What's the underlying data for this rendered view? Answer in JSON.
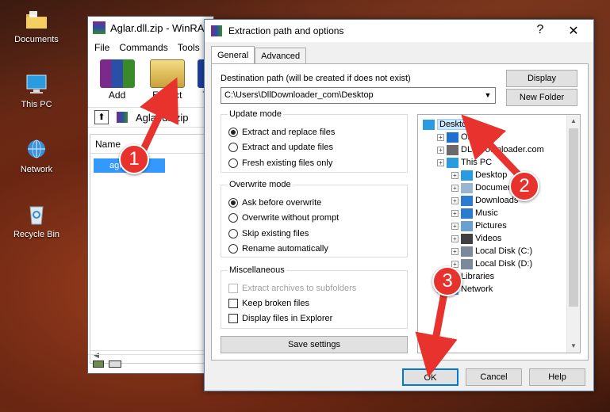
{
  "desktop": {
    "icons": [
      {
        "label": "Documents",
        "icon": "folder-icon"
      },
      {
        "label": "This PC",
        "icon": "computer-icon"
      },
      {
        "label": "Network",
        "icon": "network-icon"
      },
      {
        "label": "Recycle Bin",
        "icon": "recycle-bin-icon"
      }
    ]
  },
  "winrar": {
    "title": "Aglar.dll.zip - WinRAR",
    "menu": [
      "File",
      "Commands",
      "Tools"
    ],
    "toolbar": {
      "add": "Add",
      "extract_to": "Extract To",
      "third": "T"
    },
    "address": "Aglar.dll.zip",
    "list_header": "Name",
    "selected_file": "aglar.dll"
  },
  "dialog": {
    "title": "Extraction path and options",
    "help": "?",
    "close": "✕",
    "tabs": [
      "General",
      "Advanced"
    ],
    "dest_label": "Destination path (will be created if does not exist)",
    "dest_value": "C:\\Users\\DllDownloader_com\\Desktop",
    "display_btn": "Display",
    "new_folder_btn": "New Folder",
    "update_mode": {
      "title": "Update mode",
      "options": [
        "Extract and replace files",
        "Extract and update files",
        "Fresh existing files only"
      ],
      "selected": 0
    },
    "overwrite_mode": {
      "title": "Overwrite mode",
      "options": [
        "Ask before overwrite",
        "Overwrite without prompt",
        "Skip existing files",
        "Rename automatically"
      ],
      "selected": 0
    },
    "misc": {
      "title": "Miscellaneous",
      "options": [
        "Extract archives to subfolders",
        "Keep broken files",
        "Display files in Explorer"
      ]
    },
    "save_settings": "Save settings",
    "tree": [
      {
        "label": "Desktop",
        "level": 0,
        "selected": true
      },
      {
        "label": "OneDrive",
        "level": 1
      },
      {
        "label": "DLL Downloader.com",
        "level": 1
      },
      {
        "label": "This PC",
        "level": 1
      },
      {
        "label": "Desktop",
        "level": 2
      },
      {
        "label": "Documents",
        "level": 2
      },
      {
        "label": "Downloads",
        "level": 2
      },
      {
        "label": "Music",
        "level": 2
      },
      {
        "label": "Pictures",
        "level": 2
      },
      {
        "label": "Videos",
        "level": 2
      },
      {
        "label": "Local Disk (C:)",
        "level": 2
      },
      {
        "label": "Local Disk (D:)",
        "level": 2
      },
      {
        "label": "Libraries",
        "level": 1
      },
      {
        "label": "Network",
        "level": 1
      }
    ],
    "ok": "OK",
    "cancel": "Cancel",
    "help_btn": "Help"
  },
  "annotations": [
    "1",
    "2",
    "3"
  ],
  "colors": {
    "annotation": "#e8322d",
    "selection": "#3399ff",
    "ok_border": "#0078d7"
  }
}
